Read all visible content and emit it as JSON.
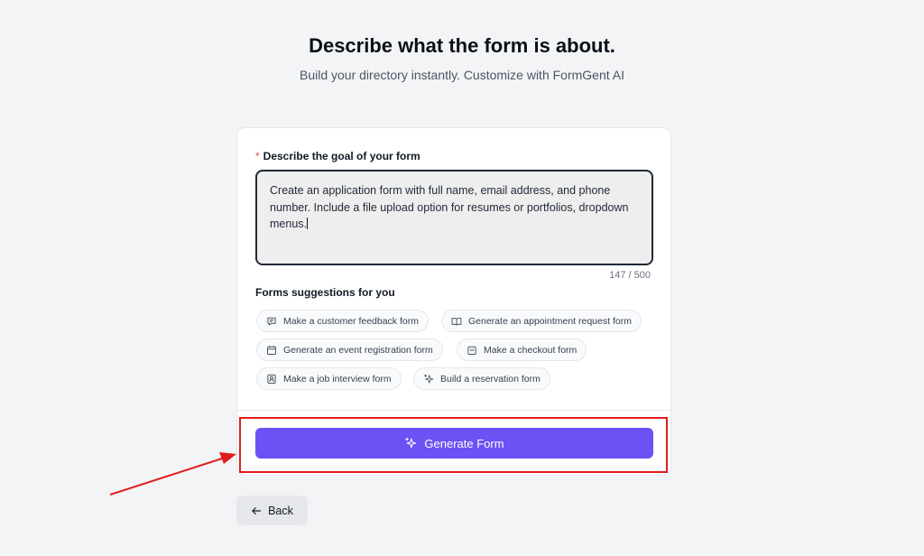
{
  "header": {
    "title": "Describe what the form is about.",
    "subtitle": "Build your directory instantly. Customize with FormGent AI"
  },
  "form": {
    "required_mark": "*",
    "goal_label": "Describe the goal of your form",
    "goal_value": "Create an application form with full name, email address, and phone number. Include a file upload option for resumes or portfolios, dropdown menus.",
    "char_counter": "147 / 500",
    "suggestions_title": "Forms suggestions for you",
    "suggestions": [
      {
        "label": "Make a customer feedback form",
        "icon": "chat-icon"
      },
      {
        "label": "Generate an appointment request form",
        "icon": "book-icon"
      },
      {
        "label": "Generate an event registration form",
        "icon": "calendar-icon"
      },
      {
        "label": "Make a checkout form",
        "icon": "bag-icon"
      },
      {
        "label": "Make a job interview form",
        "icon": "id-badge-icon"
      },
      {
        "label": "Build a reservation form",
        "icon": "sparkle-icon"
      }
    ],
    "generate_label": "Generate Form"
  },
  "nav": {
    "back_label": "Back"
  },
  "colors": {
    "primary": "#6a52f5",
    "annotation": "#e11d1d",
    "required": "#ef4444"
  }
}
